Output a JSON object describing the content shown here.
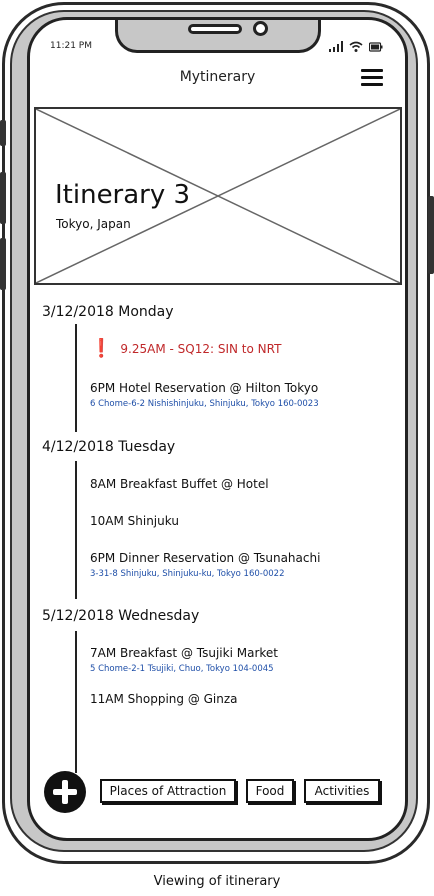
{
  "status": {
    "time": "11:21 PM"
  },
  "header": {
    "title": "Mytinerary",
    "menu_icon": "hamburger-menu-icon"
  },
  "hero": {
    "title": "Itinerary 3",
    "subtitle": "Tokyo, Japan",
    "image": "image-placeholder"
  },
  "days": [
    {
      "date": "3/12/2018 Monday",
      "items": [
        {
          "text": "9.25AM - SQ12: SIN to NRT",
          "alert": true
        },
        {
          "text": "6PM Hotel Reservation @ Hilton Tokyo",
          "address": "6 Chome-6-2 Nishishinjuku, Shinjuku, Tokyo 160-0023"
        }
      ]
    },
    {
      "date": "4/12/2018 Tuesday",
      "items": [
        {
          "text": "8AM Breakfast Buffet @ Hotel"
        },
        {
          "text": "10AM Shinjuku"
        },
        {
          "text": "6PM Dinner Reservation @ Tsunahachi",
          "address": "3-31-8 Shinjuku, Shinjuku-ku, Tokyo 160-0022"
        }
      ]
    },
    {
      "date": "5/12/2018 Wednesday",
      "items": [
        {
          "text": "7AM Breakfast @ Tsujiki Market",
          "address": "5 Chome-2-1 Tsujiki, Chuo, Tokyo 104-0045"
        },
        {
          "text": "11AM Shopping @ Ginza"
        }
      ]
    }
  ],
  "bottom_bar": {
    "add_icon": "plus-circle-icon",
    "tabs": [
      "Places of Attraction",
      "Food",
      "Activities"
    ]
  },
  "caption": "Viewing of itinerary",
  "colors": {
    "alert": "#c0282a",
    "address": "#1f4fa8",
    "frame": "#c7c7c7"
  }
}
